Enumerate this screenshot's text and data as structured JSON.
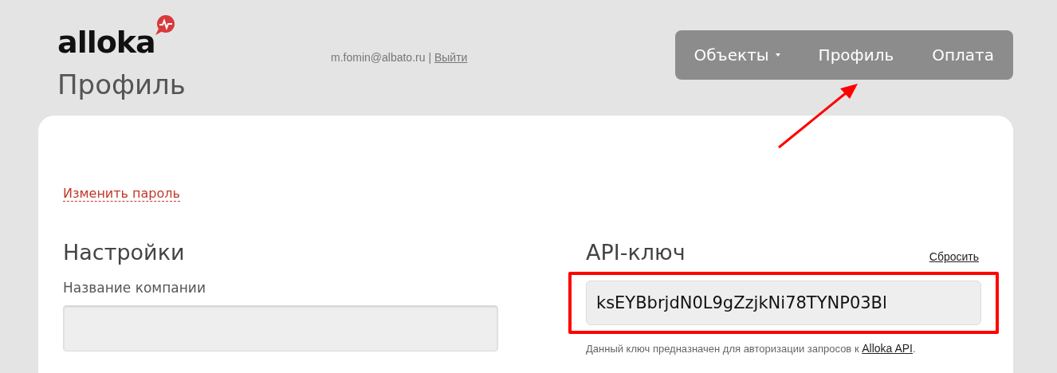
{
  "header": {
    "logo": "alloka",
    "user_email": "m.fomin@albato.ru",
    "separator": "|",
    "logout": "Выйти"
  },
  "nav": [
    {
      "label": "Объекты",
      "has_dropdown": true
    },
    {
      "label": "Профиль",
      "has_dropdown": false
    },
    {
      "label": "Оплата",
      "has_dropdown": false
    }
  ],
  "page_title": "Профиль",
  "change_password": "Изменить пароль",
  "settings": {
    "heading": "Настройки",
    "company_label": "Название компании"
  },
  "api": {
    "heading": "API-ключ",
    "reset": "Сбросить",
    "key": "ksEYBbrjdN0L9gZzjkNi78TYNP03Bl",
    "hint": "Данный ключ предназначен для авторизации запросов к",
    "hint_link": "Alloka API",
    "hint_end": "."
  }
}
